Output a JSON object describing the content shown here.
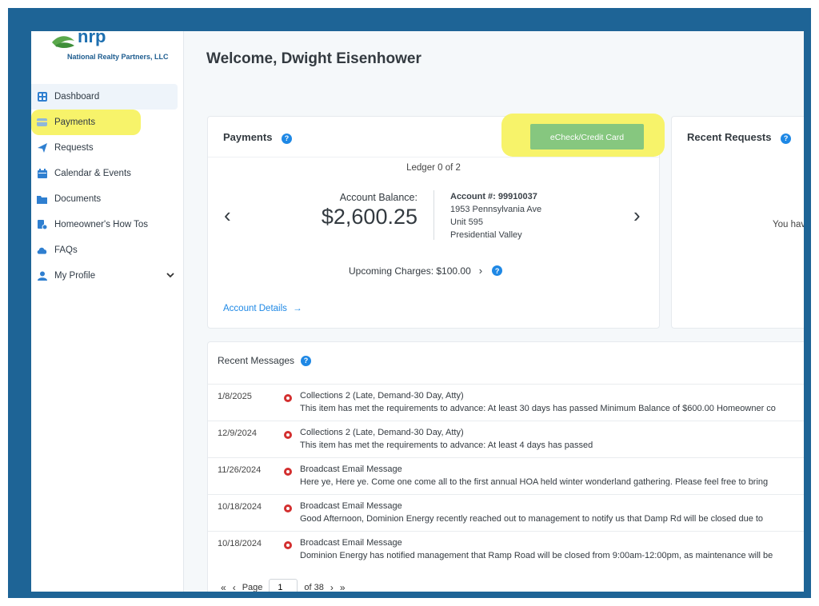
{
  "brand": {
    "company": "National Realty Partners, LLC"
  },
  "sidebar": {
    "items": [
      {
        "label": "Dashboard",
        "icon": "grid-icon"
      },
      {
        "label": "Payments",
        "icon": "card-icon"
      },
      {
        "label": "Requests",
        "icon": "send-icon"
      },
      {
        "label": "Calendar & Events",
        "icon": "calendar-icon"
      },
      {
        "label": "Documents",
        "icon": "folder-icon"
      },
      {
        "label": "Homeowner's How Tos",
        "icon": "doc-icon"
      },
      {
        "label": "FAQs",
        "icon": "cloud-icon"
      },
      {
        "label": "My Profile",
        "icon": "user-icon"
      }
    ]
  },
  "header": {
    "welcome": "Welcome, Dwight Eisenhower"
  },
  "payments": {
    "title": "Payments",
    "echeck_label": "eCheck/Credit Card",
    "ledger": "Ledger 0 of 2",
    "balance_label": "Account Balance:",
    "balance_value": "$2,600.25",
    "account_number_label": "Account #: 99910037",
    "address_line1": "1953 Pennsylvania Ave",
    "address_line2": "Unit 595",
    "address_line3": "Presidential Valley",
    "upcoming": "Upcoming Charges: $100.00",
    "account_details": "Account Details"
  },
  "requests": {
    "title": "Recent Requests",
    "empty_text": "You hav"
  },
  "messages": {
    "title": "Recent Messages",
    "rows": [
      {
        "date": "1/8/2025",
        "subject": "Collections 2 (Late, Demand-30 Day, Atty)",
        "body": "This item has met the requirements to advance: At least 30 days has passed Minimum Balance of $600.00 Homeowner co"
      },
      {
        "date": "12/9/2024",
        "subject": "Collections 2 (Late, Demand-30 Day, Atty)",
        "body": "This item has met the requirements to advance: At least 4 days has passed"
      },
      {
        "date": "11/26/2024",
        "subject": "Broadcast Email Message",
        "body": "Here ye, Here ye. Come one come all to the first annual HOA held winter wonderland gathering. Please feel free to bring"
      },
      {
        "date": "10/18/2024",
        "subject": "Broadcast Email Message",
        "body": "Good Afternoon, Dominion Energy recently reached out to management to notify us that Damp Rd will be closed due to"
      },
      {
        "date": "10/18/2024",
        "subject": "Broadcast Email Message",
        "body": "Dominion Energy has notified management that Ramp Road will be closed from 9:00am-12:00pm, as maintenance will be"
      }
    ]
  },
  "pager": {
    "page_label": "Page",
    "page_value": "1",
    "of_label": "of 38"
  },
  "colors": {
    "frame": "#1e6496",
    "accent": "#1e88e5",
    "highlight": "#f7f36a",
    "echeck": "#86c77f",
    "alert": "#d32f2f"
  }
}
